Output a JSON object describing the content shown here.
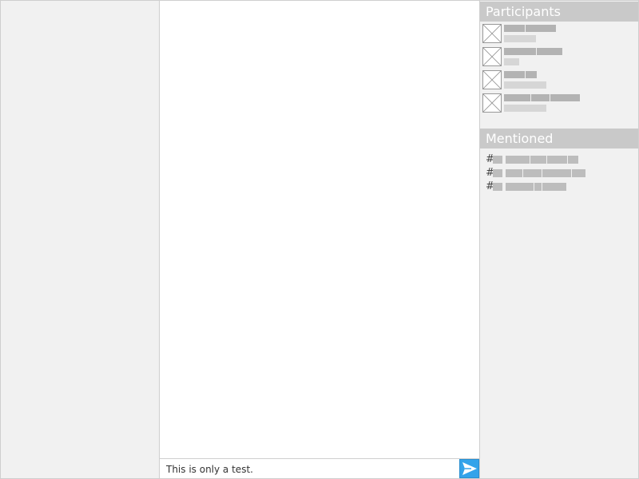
{
  "participants": {
    "header": "Participants",
    "items": [
      {
        "name_segments": [
          26,
          38
        ],
        "status_width": 40
      },
      {
        "name_segments": [
          40,
          32
        ],
        "status_width": 19
      },
      {
        "name_segments": [
          26,
          14
        ],
        "status_width": 53
      },
      {
        "name_segments": [
          33,
          23,
          37
        ],
        "status_width": 53
      }
    ]
  },
  "mentioned": {
    "header": "Mentioned",
    "items": [
      {
        "hash": "#",
        "segments": [
          30,
          20,
          25,
          13
        ]
      },
      {
        "hash": "#",
        "segments": [
          21,
          23,
          36,
          17
        ]
      },
      {
        "hash": "#",
        "segments": [
          35,
          9,
          30
        ]
      }
    ]
  },
  "composer": {
    "message": "This is only a test.",
    "send_icon": "send-icon"
  },
  "colors": {
    "panel_bg": "#f1f1f1",
    "header_bg": "#c9c9c9",
    "send_accent": "#33a3ea"
  }
}
